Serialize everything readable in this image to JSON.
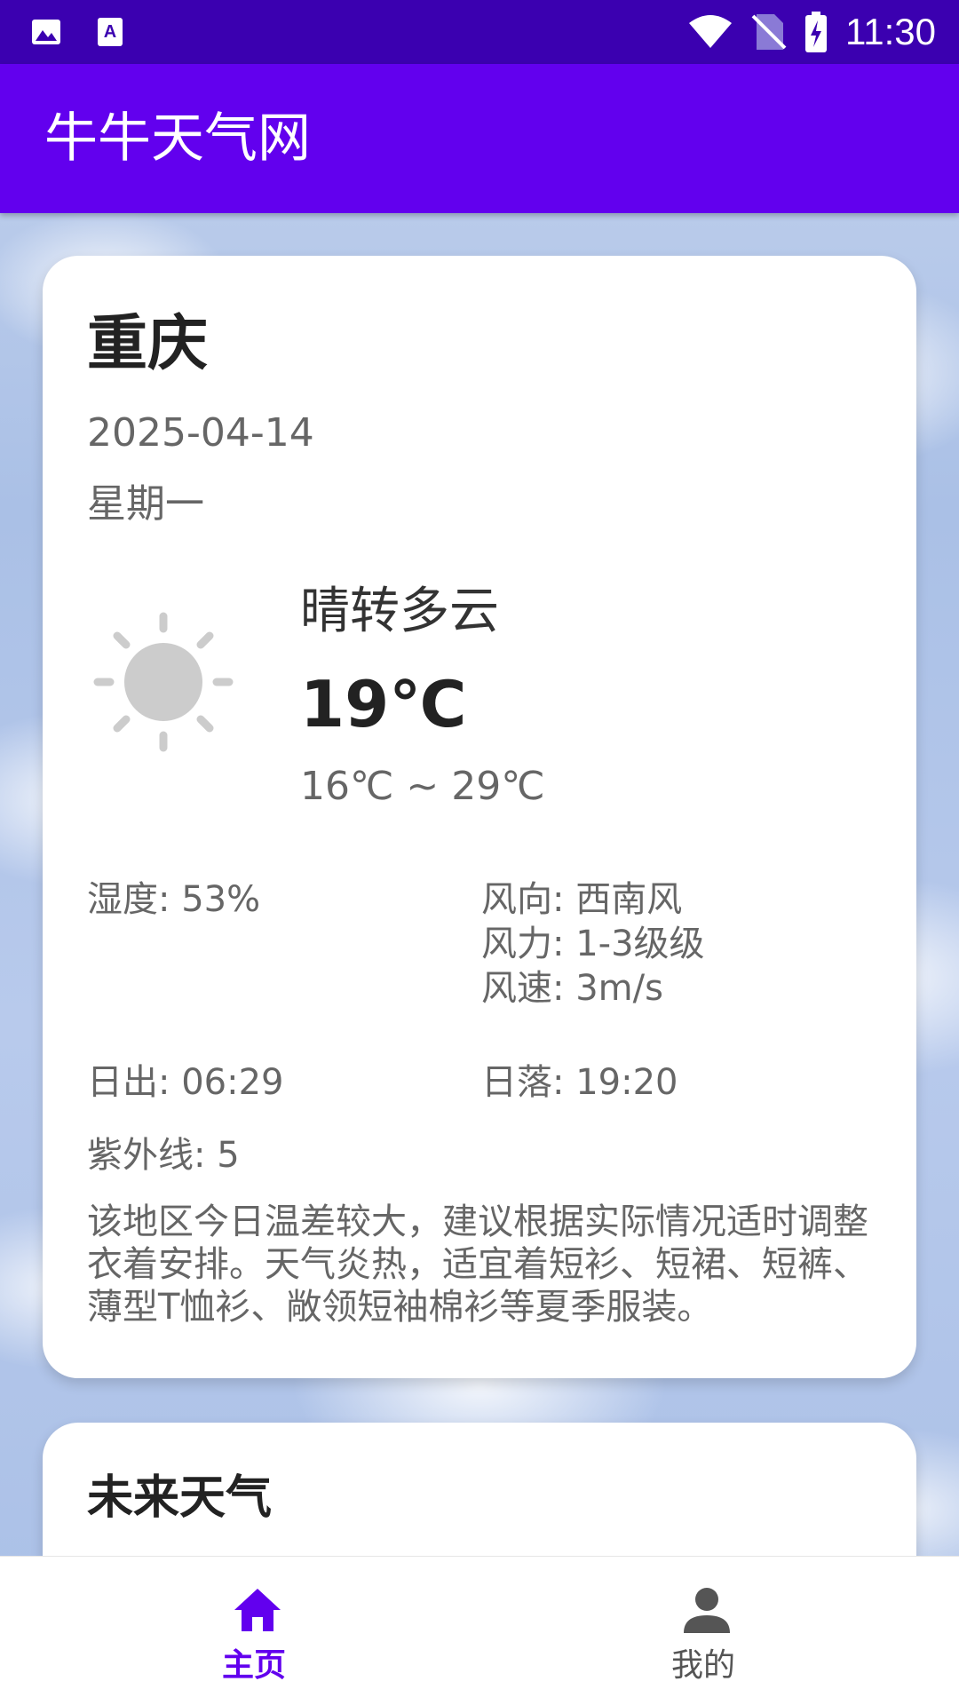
{
  "status_bar": {
    "time": "11:30",
    "icons": [
      "image-icon",
      "text-a-icon",
      "wifi-icon",
      "no-sim-icon",
      "battery-charging-icon"
    ]
  },
  "app_bar": {
    "title": "牛牛天气网"
  },
  "today": {
    "city": "重庆",
    "date": "2025-04-14",
    "weekday": "星期一",
    "icon": "sun-icon",
    "condition": "晴转多云",
    "temperature": "19℃",
    "range": "16℃ ~ 29℃",
    "humidity": "湿度: 53%",
    "wind_direction": "风向: 西南风",
    "wind_power": "风力: 1-3级级",
    "wind_speed": "风速: 3m/s",
    "sunrise": "日出: 06:29",
    "sunset": "日落: 19:20",
    "uv": "紫外线: 5",
    "advice": "该地区今日温差较大，建议根据实际情况适时调整衣着安排。天气炎热，适宜着短衫、短裙、短裤、薄型T恤衫、敞领短袖棉衫等夏季服装。"
  },
  "forecast": {
    "title": "未来天气"
  },
  "bottom_nav": {
    "items": [
      {
        "label": "主页",
        "icon": "home-icon",
        "active": true
      },
      {
        "label": "我的",
        "icon": "person-icon",
        "active": false
      }
    ]
  },
  "colors": {
    "status_bar": "#3b00b0",
    "primary": "#6200ee",
    "card": "#ffffff",
    "text_dark": "#222222",
    "text_muted": "#666666",
    "sun": "#cccccc"
  }
}
